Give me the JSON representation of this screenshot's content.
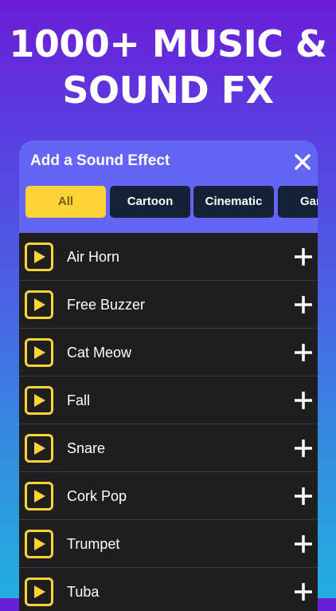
{
  "headline": {
    "line1": "1000+ MUSIC &",
    "line2": "SOUND FX"
  },
  "panel": {
    "title": "Add a Sound Effect",
    "close_icon": "close-icon"
  },
  "tabs": [
    {
      "label": "All",
      "active": true
    },
    {
      "label": "Cartoon",
      "active": false
    },
    {
      "label": "Cinematic",
      "active": false
    },
    {
      "label": "Gam",
      "active": false
    }
  ],
  "sounds": [
    {
      "name": "Air Horn"
    },
    {
      "name": "Free Buzzer"
    },
    {
      "name": "Cat Meow"
    },
    {
      "name": "Fall"
    },
    {
      "name": "Snare"
    },
    {
      "name": "Cork Pop"
    },
    {
      "name": "Trumpet"
    },
    {
      "name": "Tuba"
    }
  ],
  "colors": {
    "accent_yellow": "#fdd437",
    "header_purple": "#6464f6",
    "tab_dark": "#142238",
    "list_bg": "#1e1e1e"
  },
  "icons": {
    "play": "play-icon",
    "add": "plus-icon"
  }
}
